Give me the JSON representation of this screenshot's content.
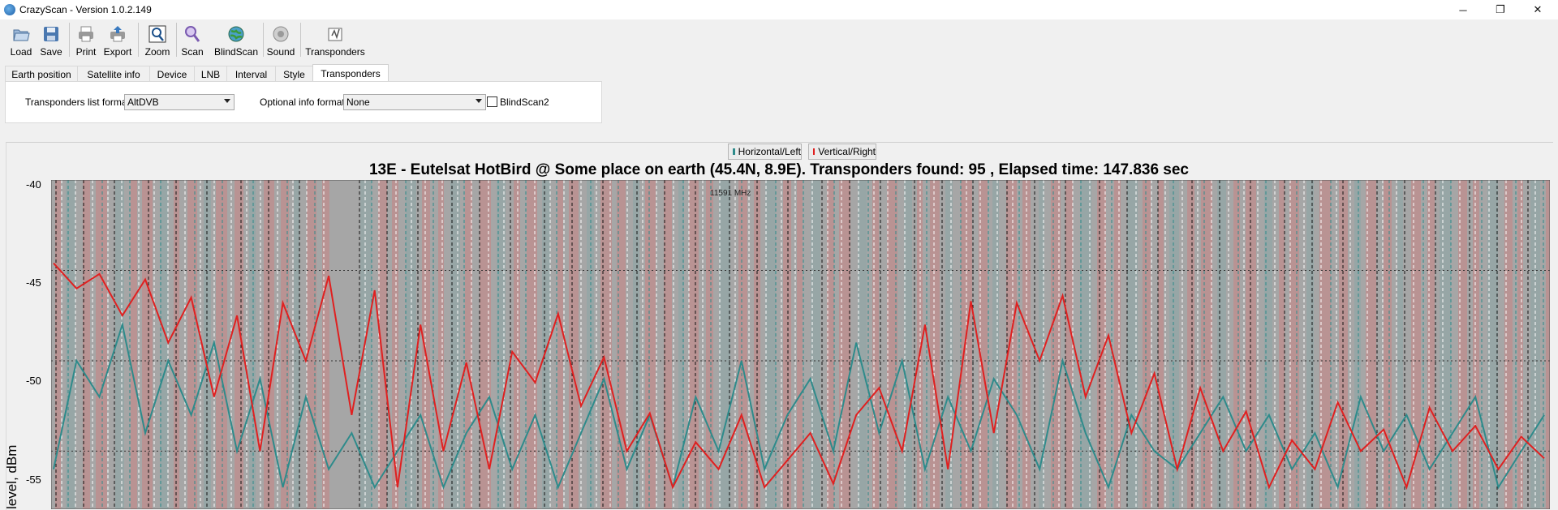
{
  "window": {
    "title": "CrazyScan - Version 1.0.2.149",
    "controls": {
      "minimize": "─",
      "restore": "❐",
      "close": "✕"
    }
  },
  "toolbar": {
    "load": "Load",
    "save": "Save",
    "print": "Print",
    "export": "Export",
    "zoom": "Zoom",
    "scan": "Scan",
    "blindscan": "BlindScan",
    "sound": "Sound",
    "transponders": "Transponders"
  },
  "tabs": [
    "Earth position",
    "Satellite info",
    "Device",
    "LNB",
    "Interval",
    "Style",
    "Transponders"
  ],
  "panel": {
    "list_format_label": "Transponders list format",
    "list_format_value": "AltDVB",
    "optional_label": "Optional info format",
    "optional_value": "None",
    "blindscan2_label": "BlindScan2",
    "blindscan2_checked": false
  },
  "chart_data": {
    "type": "line",
    "title": "13E - Eutelsat HotBird @ Some place on earth (45.4N, 8.9E). Transponders found: 95 , Elapsed time: 147.836 sec",
    "ylabel": "level, dBm",
    "xlabel": "",
    "ylim": [
      -57,
      -40
    ],
    "yticks": [
      -40,
      -45,
      -50,
      -55
    ],
    "grid": true,
    "cursor_label": "11591 MHz",
    "legend_placement": "top-center",
    "series": [
      {
        "name": "Horizontal/Left",
        "color": "#2e8b8b",
        "values": [
          -56,
          -50,
          -52,
          -48,
          -54,
          -50,
          -53,
          -49,
          -55,
          -51,
          -57,
          -52,
          -56,
          -54,
          -57,
          -55,
          -53,
          -57,
          -54,
          -52,
          -56,
          -53,
          -57,
          -54,
          -51,
          -56,
          -53,
          -57,
          -52,
          -55,
          -50,
          -56,
          -53,
          -51,
          -55,
          -49,
          -54,
          -50,
          -56,
          -52,
          -55,
          -51,
          -53,
          -56,
          -50,
          -54,
          -57,
          -53,
          -55,
          -56,
          -54,
          -52,
          -55,
          -53,
          -56,
          -54,
          -57,
          -52,
          -55,
          -53,
          -56,
          -54,
          -52,
          -57,
          -55,
          -53
        ]
      },
      {
        "name": "Vertical/Right",
        "color": "#e02020",
        "values": [
          -44.6,
          -46,
          -45.2,
          -47.5,
          -45.5,
          -49,
          -46.5,
          -52,
          -47.5,
          -55,
          -46.8,
          -50,
          -45.3,
          -53,
          -46.1,
          -57,
          -48,
          -55,
          -50.1,
          -56,
          -49.5,
          -51.2,
          -47.4,
          -52.5,
          -49.8,
          -55,
          -52.9,
          -57,
          -54.5,
          -56,
          -53,
          -57,
          -55.5,
          -54,
          -56.8,
          -53,
          -51.5,
          -55,
          -48,
          -56,
          -46.7,
          -54,
          -46.8,
          -50,
          -46.4,
          -52,
          -48.6,
          -54,
          -50.7,
          -56,
          -51.5,
          -55,
          -52.8,
          -57,
          -54.4,
          -56,
          -52.3,
          -55,
          -53.8,
          -57,
          -52.6,
          -55,
          -53.6,
          -56,
          -54.2,
          -55.4
        ]
      }
    ]
  }
}
